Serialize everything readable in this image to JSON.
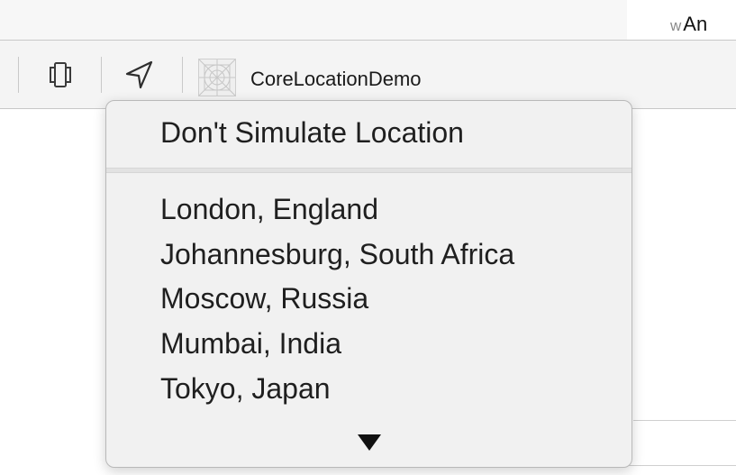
{
  "editor": {
    "partial_prefix": "w",
    "partial_text": "An"
  },
  "toolbar": {
    "device_icon": "device-frame-icon",
    "location_icon": "location-arrow-icon",
    "app_icon": "app-icon-placeholder",
    "scheme_label": "CoreLocationDemo"
  },
  "location_menu": {
    "dont_simulate": "Don't Simulate Location",
    "items": [
      "London, England",
      "Johannesburg, South Africa",
      "Moscow, Russia",
      "Mumbai, India",
      "Tokyo, Japan"
    ],
    "scroll_indicator_icon": "scroll-down-arrow-icon"
  }
}
